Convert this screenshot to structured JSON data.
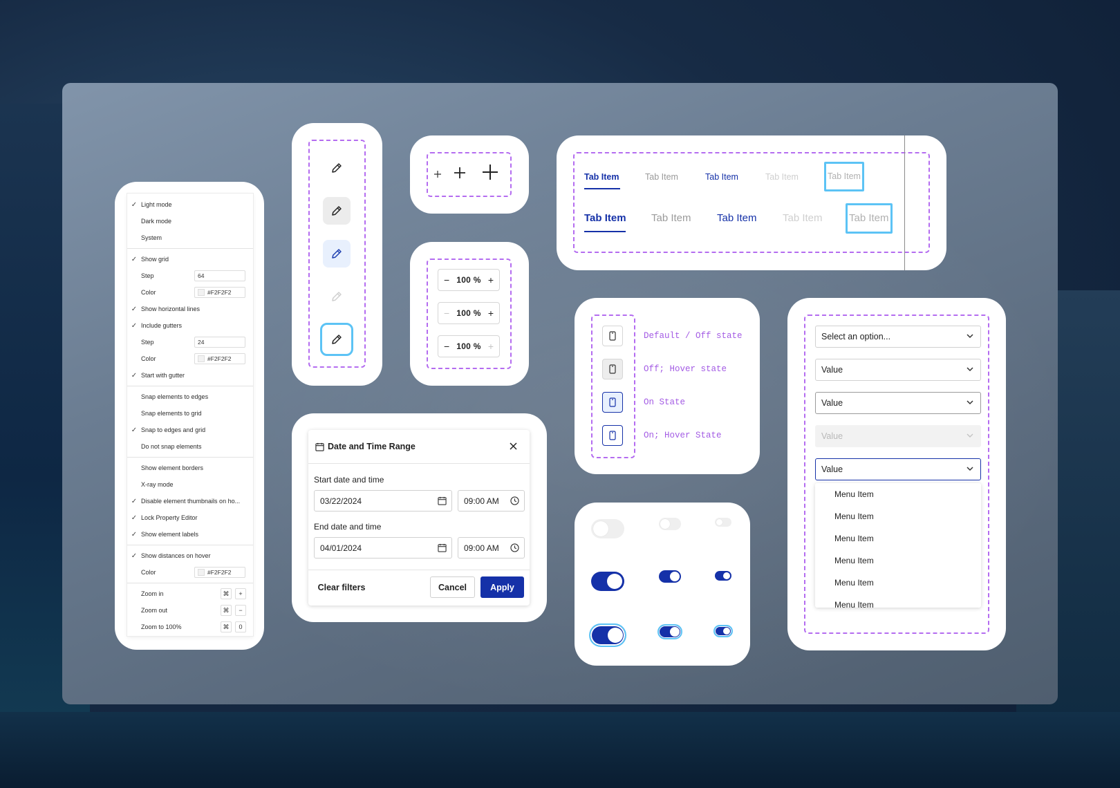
{
  "menu": {
    "items": [
      {
        "label": "Light mode",
        "checked": true
      },
      {
        "label": "Dark mode",
        "checked": false
      },
      {
        "label": "System",
        "checked": false
      },
      {
        "label": "Show grid",
        "checked": true
      },
      {
        "label": "Step",
        "value": "64"
      },
      {
        "label": "Color",
        "value": "#F2F2F2"
      },
      {
        "label": "Show horizontal lines",
        "checked": true
      },
      {
        "label": "Include gutters",
        "checked": true
      },
      {
        "label": "Step",
        "value": "24"
      },
      {
        "label": "Color",
        "value": "#F2F2F2"
      },
      {
        "label": "Start with gutter",
        "checked": true
      },
      {
        "label": "Snap elements to edges",
        "checked": false
      },
      {
        "label": "Snap elements to grid",
        "checked": false
      },
      {
        "label": "Snap to edges and grid",
        "checked": true
      },
      {
        "label": "Do not snap elements",
        "checked": false
      },
      {
        "label": "Show element borders",
        "checked": false
      },
      {
        "label": "X-ray mode",
        "checked": false
      },
      {
        "label": "Disable element thumbnails on ho...",
        "checked": true
      },
      {
        "label": "Lock Property Editor",
        "checked": true
      },
      {
        "label": "Show element labels",
        "checked": true
      },
      {
        "label": "Show distances on hover",
        "checked": true
      },
      {
        "label": "Color",
        "value": "#F2F2F2"
      },
      {
        "label": "Zoom in",
        "key1": "⌘",
        "key2": "+"
      },
      {
        "label": "Zoom out",
        "key1": "⌘",
        "key2": "−"
      },
      {
        "label": "Zoom to 100%",
        "key1": "⌘",
        "key2": "0"
      }
    ]
  },
  "tabs": {
    "small": [
      "Tab Item",
      "Tab Item",
      "Tab Item",
      "Tab Item",
      "Tab Item"
    ],
    "large": [
      "Tab Item",
      "Tab Item",
      "Tab Item",
      "Tab Item",
      "Tab Item"
    ]
  },
  "zoom": {
    "value": "100 %"
  },
  "date_dialog": {
    "title": "Date and Time Range",
    "start_label": "Start date and time",
    "start_date": "03/22/2024",
    "start_time": "09:00 AM",
    "end_label": "End date and time",
    "end_date": "04/01/2024",
    "end_time": "09:00 AM",
    "clear": "Clear filters",
    "cancel": "Cancel",
    "apply": "Apply"
  },
  "checkbox_states": [
    "Default / Off state",
    "Off; Hover state",
    "On State",
    "On; Hover State"
  ],
  "select": {
    "placeholder": "Select an option...",
    "value": "Value",
    "menu_items": [
      "Menu Item",
      "Menu Item",
      "Menu Item",
      "Menu Item",
      "Menu Item",
      "Menu Item"
    ]
  },
  "colors": {
    "accent": "#1531a8",
    "dashed": "#b46cf0",
    "focus": "#5cc3f5",
    "disabled": "#c4c4c4"
  }
}
